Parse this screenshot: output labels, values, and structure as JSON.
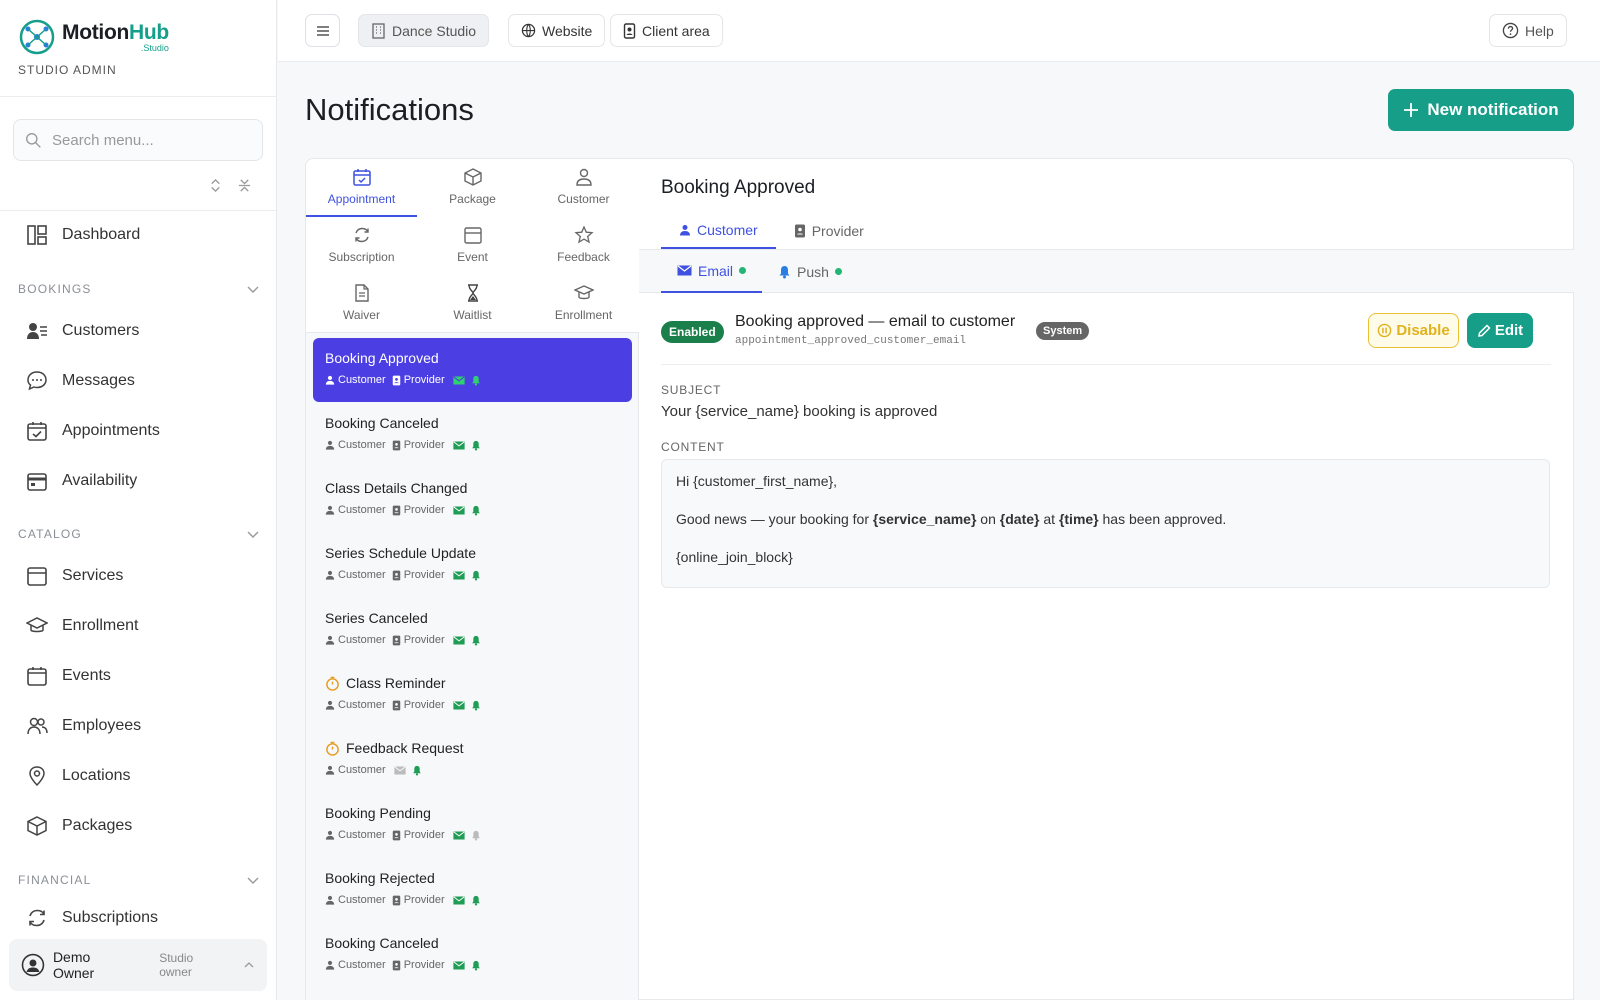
{
  "brand": {
    "name_a": "Motion",
    "name_b": "Hub",
    "sub": ".Studio",
    "role": "STUDIO ADMIN"
  },
  "sidebar": {
    "search_placeholder": "Search menu...",
    "dashboard": "Dashboard",
    "sections": [
      "BOOKINGS",
      "CATALOG",
      "FINANCIAL"
    ],
    "bookings": [
      "Customers",
      "Messages",
      "Appointments",
      "Availability"
    ],
    "catalog": [
      "Services",
      "Enrollment",
      "Events",
      "Employees",
      "Locations",
      "Packages"
    ],
    "financial": [
      "Subscriptions"
    ],
    "user": {
      "name": "Demo Owner",
      "role": "Studio owner"
    }
  },
  "topbar": {
    "studio": "Dance Studio",
    "website": "Website",
    "client": "Client area",
    "help": "Help"
  },
  "page": {
    "title": "Notifications",
    "new_button": "New notification"
  },
  "categories": [
    "Appointment",
    "Package",
    "Customer",
    "Subscription",
    "Event",
    "Feedback",
    "Waiver",
    "Waitlist",
    "Enrollment"
  ],
  "list": {
    "customer": "Customer",
    "provider": "Provider",
    "items": [
      "Booking Approved",
      "Booking Canceled",
      "Class Details Changed",
      "Series Schedule Update",
      "Series Canceled",
      "Class Reminder",
      "Feedback Request",
      "Booking Pending",
      "Booking Rejected",
      "Booking Canceled"
    ]
  },
  "detail": {
    "title": "Booking Approved",
    "audience_tabs": [
      "Customer",
      "Provider"
    ],
    "channel_tabs": [
      "Email",
      "Push"
    ],
    "enabled": "Enabled",
    "template_name": "Booking approved — email to customer",
    "template_key": "appointment_approved_customer_email",
    "system": "System",
    "disable": "Disable",
    "edit": "Edit",
    "subject_label": "SUBJECT",
    "subject": "Your {service_name} booking is approved",
    "content_label": "CONTENT",
    "content_line1": "Hi {customer_first_name},",
    "content_line2_a": "Good news — your booking for ",
    "content_line2_b": "{service_name}",
    "content_line2_c": " on ",
    "content_line2_d": "{date}",
    "content_line2_e": " at ",
    "content_line2_f": "{time}",
    "content_line2_g": " has been approved.",
    "content_line3": "{online_join_block}"
  },
  "colors": {
    "accent": "#169e88",
    "selected": "#4b3ee3",
    "tab_active": "#3f51e0",
    "enabled": "#1b7f4b",
    "warning": "#e0b21c"
  }
}
